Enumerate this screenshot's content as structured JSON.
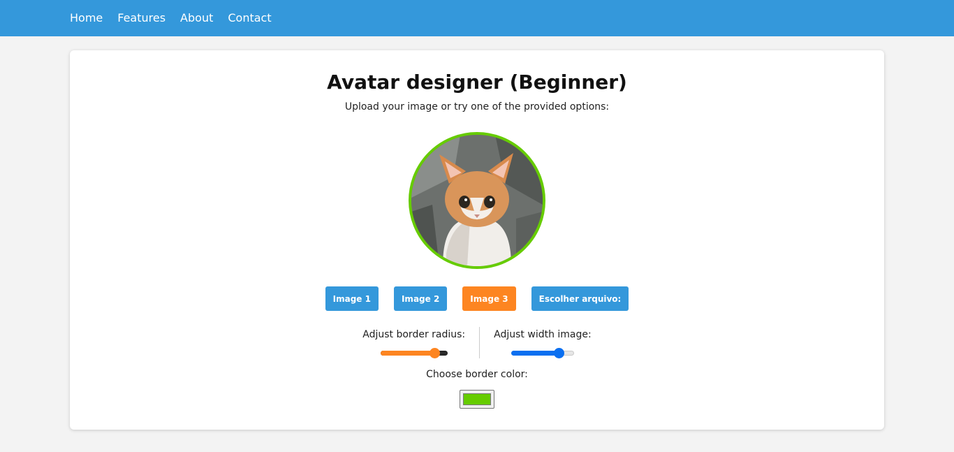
{
  "nav": {
    "items": [
      {
        "label": "Home"
      },
      {
        "label": "Features"
      },
      {
        "label": "About"
      },
      {
        "label": "Contact"
      }
    ]
  },
  "designer": {
    "title": "Avatar designer (Beginner)",
    "subtitle": "Upload your image or try one of the provided options:",
    "buttons": [
      {
        "label": "Image 1",
        "active": false
      },
      {
        "label": "Image 2",
        "active": false
      },
      {
        "label": "Image 3",
        "active": true
      },
      {
        "label": "Escolher arquivo:",
        "active": false
      }
    ],
    "border_radius": {
      "label": "Adjust border radius:",
      "value_fraction": 0.86
    },
    "width_image": {
      "label": "Adjust width image:",
      "value_fraction": 0.82
    },
    "border_color": {
      "label": "Choose border color:",
      "value": "#66cc00"
    }
  },
  "colors": {
    "nav_bg": "#3498db",
    "button": "#3498db",
    "button_active": "#fd8521",
    "radius_slider": "#fd8521",
    "width_slider": "#0a6ff0",
    "avatar_border": "#66cc00"
  }
}
